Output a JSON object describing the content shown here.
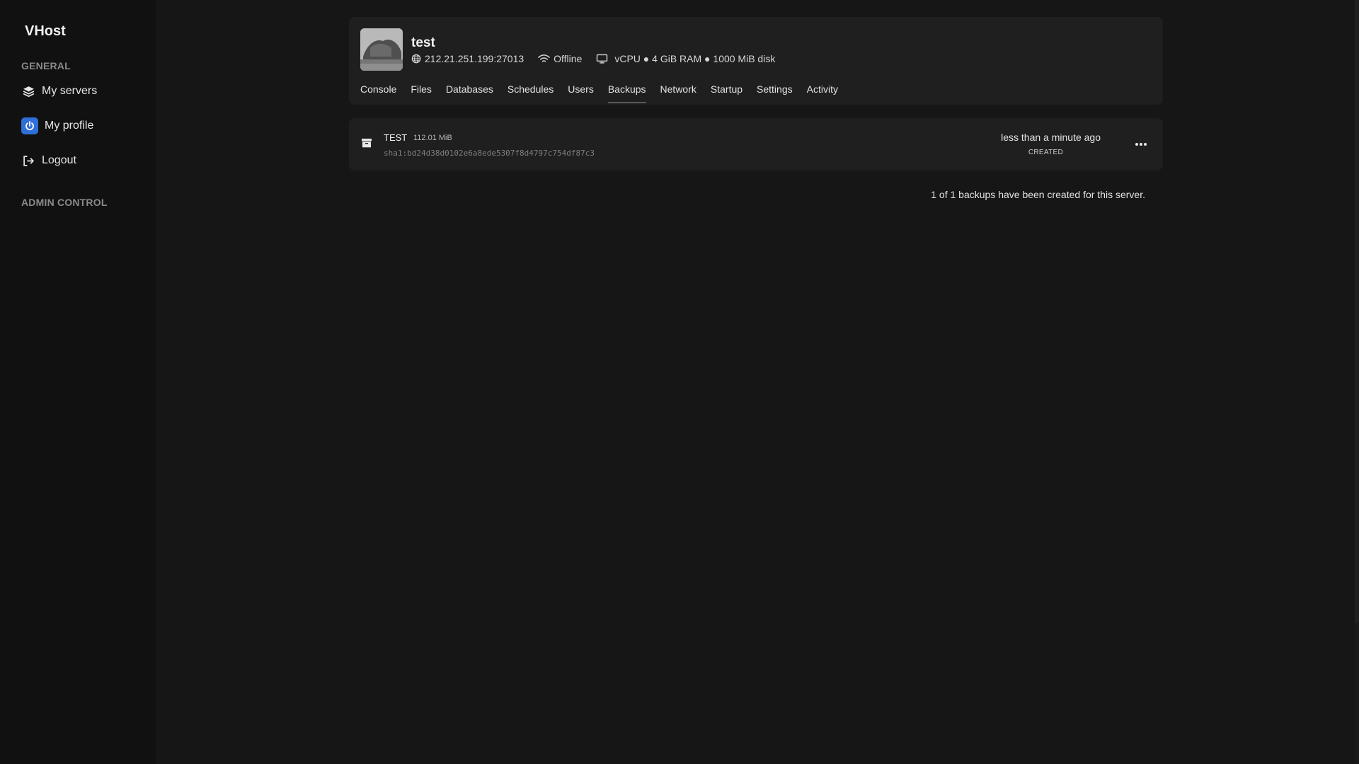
{
  "sidebar": {
    "brand": "VHost",
    "sections": {
      "general": "GENERAL",
      "admin": "ADMIN CONTROL"
    },
    "items": [
      {
        "label": "My servers",
        "icon": "layers-icon"
      },
      {
        "label": "My profile",
        "icon": "power-icon"
      },
      {
        "label": "Logout",
        "icon": "logout-icon"
      }
    ]
  },
  "server": {
    "name": "test",
    "address": "212.21.251.199:27013",
    "status": "Offline",
    "resources": "vCPU ● 4 GiB RAM ● 1000 MiB disk",
    "tabs": [
      "Console",
      "Files",
      "Databases",
      "Schedules",
      "Users",
      "Backups",
      "Network",
      "Startup",
      "Settings",
      "Activity"
    ],
    "active_tab": "Backups"
  },
  "backups": [
    {
      "name": "TEST",
      "size": "112.01 MiB",
      "checksum": "sha1:bd24d38d0102e6a8ede5307f8d4797c754df87c3",
      "time": "less than a minute ago",
      "status": "CREATED"
    }
  ],
  "footer": {
    "note": "1 of 1 backups have been created for this server."
  },
  "colors": {
    "background": "#161616",
    "sidebar": "#111111",
    "card": "#1f1f1f",
    "profile_accent": "#2f6fd8"
  }
}
